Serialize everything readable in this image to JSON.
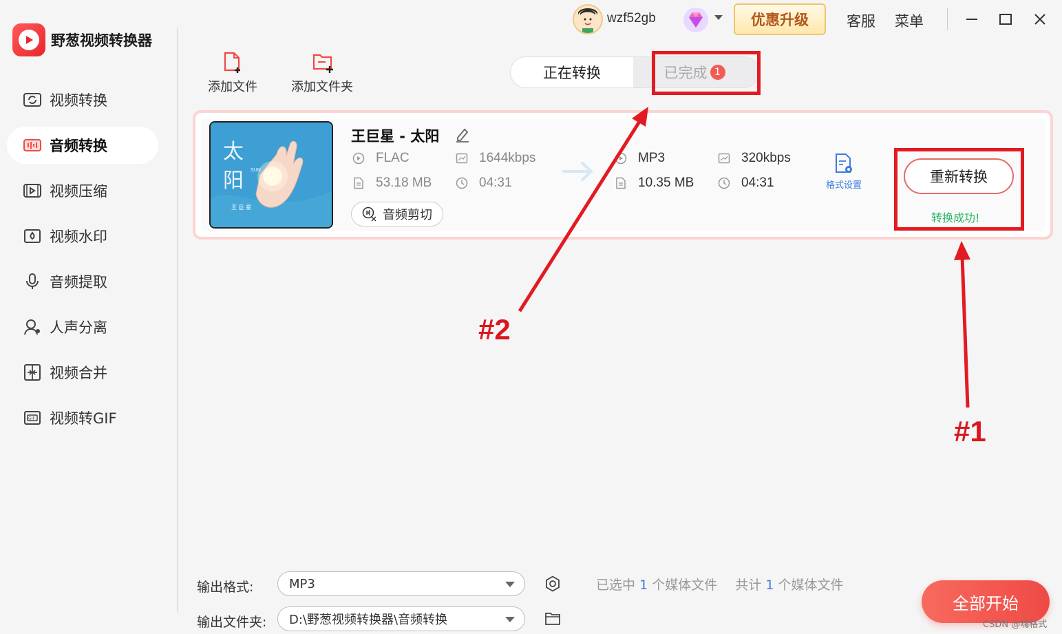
{
  "app": {
    "name": "野葱视频转换器",
    "accent_color": "#e8262c"
  },
  "sidebar": {
    "items": [
      {
        "label": "视频转换",
        "icon": "video-convert-icon",
        "active": false
      },
      {
        "label": "音频转换",
        "icon": "audio-convert-icon",
        "active": true
      },
      {
        "label": "视频压缩",
        "icon": "video-compress-icon",
        "active": false
      },
      {
        "label": "视频水印",
        "icon": "video-watermark-icon",
        "active": false
      },
      {
        "label": "音频提取",
        "icon": "audio-extract-icon",
        "active": false
      },
      {
        "label": "人声分离",
        "icon": "vocal-separate-icon",
        "active": false
      },
      {
        "label": "视频合并",
        "icon": "video-merge-icon",
        "active": false
      },
      {
        "label": "视频转GIF",
        "icon": "video-to-gif-icon",
        "active": false
      }
    ]
  },
  "titlebar": {
    "username": "wzf52gb",
    "upgrade_label": "优惠升级",
    "service_label": "客服",
    "menu_label": "菜单"
  },
  "toolbar": {
    "add_file_label": "添加文件",
    "add_folder_label": "添加文件夹"
  },
  "tabs": {
    "converting_label": "正在转换",
    "done_label": "已完成",
    "done_count": "1"
  },
  "task": {
    "title": "王巨星 - 太阳",
    "cover_text": "太 阳",
    "cover_sub": "SUN",
    "cover_artist": "王 巨 星",
    "source": {
      "format": "FLAC",
      "bitrate": "1644kbps",
      "size": "53.18 MB",
      "duration": "04:31"
    },
    "target": {
      "format": "MP3",
      "bitrate": "320kbps",
      "size": "10.35 MB",
      "duration": "04:31"
    },
    "trim_label": "音频剪切",
    "format_settings_label": "格式设置",
    "reconvert_label": "重新转换",
    "status_text": "转换成功!"
  },
  "annotations": {
    "label_1": "#1",
    "label_2": "#2",
    "color": "#e21b23"
  },
  "bottom": {
    "output_format_label": "输出格式:",
    "output_format_value": "MP3",
    "output_folder_label": "输出文件夹:",
    "output_folder_value": "D:\\野葱视频转换器\\音频转换",
    "selected_prefix": "已选中",
    "selected_count": "1",
    "selected_suffix": "个媒体文件",
    "total_prefix": "共计",
    "total_count": "1",
    "total_suffix": "个媒体文件",
    "start_all_label": "全部开始"
  },
  "watermark": "CSDN @嗨格式"
}
